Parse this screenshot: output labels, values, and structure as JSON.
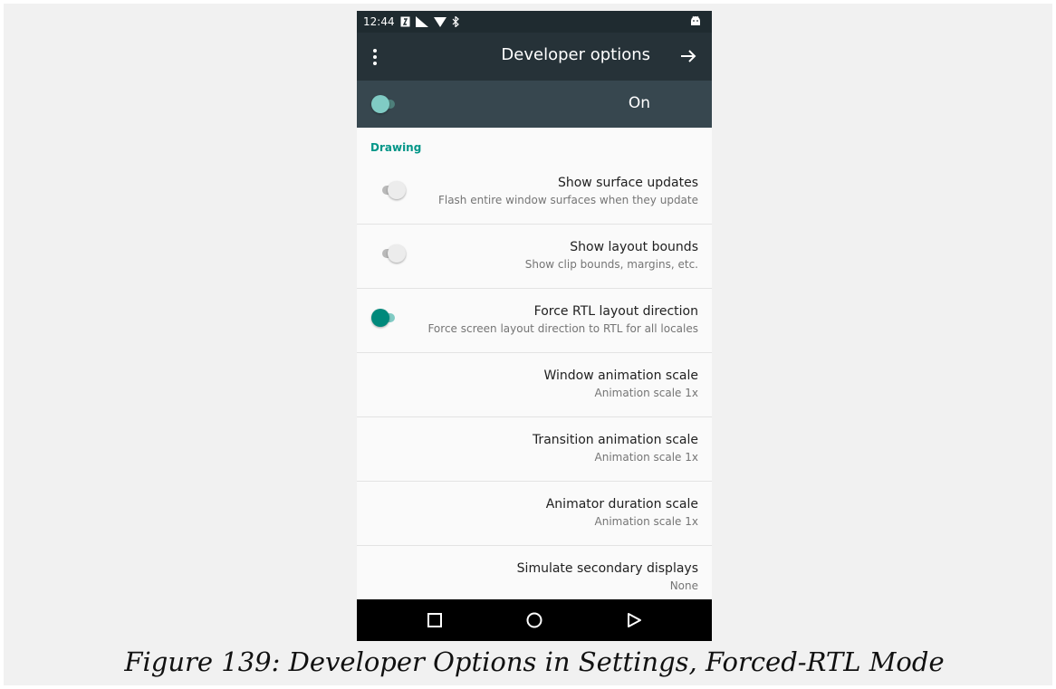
{
  "statusbar": {
    "time": "12:44"
  },
  "toolbar": {
    "title": "Developer options"
  },
  "master_switch": {
    "label": "On",
    "state": "on"
  },
  "section": {
    "title": "Drawing"
  },
  "prefs": [
    {
      "title": "Show surface updates",
      "summary": "Flash entire window surfaces when they update",
      "switch": "off"
    },
    {
      "title": "Show layout bounds",
      "summary": "Show clip bounds, margins, etc.",
      "switch": "off"
    },
    {
      "title": "Force RTL layout direction",
      "summary": "Force screen layout direction to RTL for all locales",
      "switch": "on"
    },
    {
      "title": "Window animation scale",
      "summary": "Animation scale 1x"
    },
    {
      "title": "Transition animation scale",
      "summary": "Animation scale 1x"
    },
    {
      "title": "Animator duration scale",
      "summary": "Animation scale 1x"
    },
    {
      "title": "Simulate secondary displays",
      "summary": "None"
    }
  ],
  "caption": "Figure 139: Developer Options in Settings, Forced-RTL Mode",
  "colors": {
    "accent": "#009688",
    "toolbar": "#263238",
    "master_bar": "#37474f",
    "statusbar": "#1f2b30"
  }
}
